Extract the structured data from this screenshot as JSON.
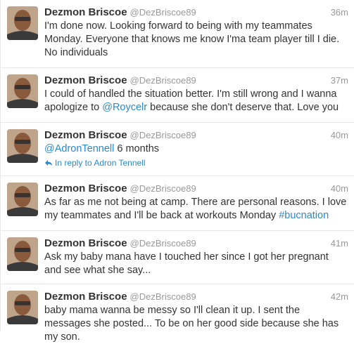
{
  "tweets": [
    {
      "name": "Dezmon Briscoe",
      "handle": "@DezBriscoe89",
      "time": "36m",
      "text": "I'm done now. Looking forward to being with my teammates Monday. Everyone that knows me know I'ma team player till I die. No individuals"
    },
    {
      "name": "Dezmon Briscoe",
      "handle": "@DezBriscoe89",
      "time": "37m",
      "text_before": "I could of handled the situation better. I'm still wrong and I wanna apologize to ",
      "mention": "@Roycelr",
      "text_after": " because she don't deserve that. Love you"
    },
    {
      "name": "Dezmon Briscoe",
      "handle": "@DezBriscoe89",
      "time": "40m",
      "mention": "@AdronTennell",
      "text_after": " 6 months",
      "reply_label": "In reply to Adron Tennell"
    },
    {
      "name": "Dezmon Briscoe",
      "handle": "@DezBriscoe89",
      "time": "40m",
      "text_before": "As far as me not being at camp. There are personal reasons. I love my teammates and I'll be back at workouts Monday ",
      "hashtag": "#bucnation"
    },
    {
      "name": "Dezmon Briscoe",
      "handle": "@DezBriscoe89",
      "time": "41m",
      "text": "Ask my baby mana have I touched her since I got her pregnant and see what she say..."
    },
    {
      "name": "Dezmon Briscoe",
      "handle": "@DezBriscoe89",
      "time": "42m",
      "text": "baby mama wanna be messy so I'll clean it up. I sent the messages she posted... To be on her good side because she has my son."
    }
  ],
  "colors": {
    "link": "#2a8acc",
    "muted": "#999999",
    "text": "#333333",
    "divider": "#e8e8e8"
  },
  "icons": {
    "reply": "reply-arrow-icon",
    "avatar": "profile-photo"
  }
}
